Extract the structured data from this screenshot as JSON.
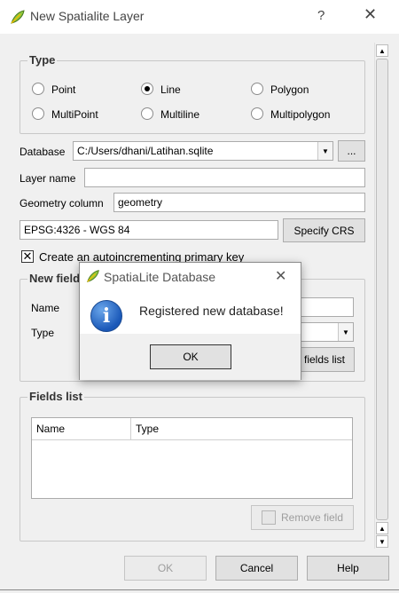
{
  "window": {
    "title": "New Spatialite Layer",
    "help_glyph": "?",
    "close_glyph": "✕",
    "icon": "qgis-leaf-icon"
  },
  "type_group": {
    "title": "Type",
    "options": [
      {
        "label": "Point",
        "checked": false
      },
      {
        "label": "Line",
        "checked": true
      },
      {
        "label": "Polygon",
        "checked": false
      },
      {
        "label": "MultiPoint",
        "checked": false
      },
      {
        "label": "Multiline",
        "checked": false
      },
      {
        "label": "Multipolygon",
        "checked": false
      }
    ]
  },
  "database": {
    "label": "Database",
    "value": "C:/Users/dhani/Latihan.sqlite",
    "browse_label": "..."
  },
  "layer_name": {
    "label": "Layer name",
    "value": ""
  },
  "geometry_column": {
    "label": "Geometry column",
    "value": "geometry"
  },
  "crs": {
    "value": "EPSG:4326 - WGS 84",
    "button_label": "Specify CRS"
  },
  "primary_key": {
    "label": "Create an autoincrementing primary key",
    "checked": true
  },
  "new_field": {
    "title": "New field",
    "name_label": "Name",
    "type_label": "Type",
    "add_button_label": "fields list"
  },
  "fields_list": {
    "title": "Fields list",
    "columns": [
      "Name",
      "Type"
    ],
    "rows": [],
    "remove_button_label": "Remove field"
  },
  "buttons": {
    "ok": "OK",
    "cancel": "Cancel",
    "help": "Help"
  },
  "popup": {
    "title": "SpatiaLite Database",
    "message": "Registered new database!",
    "ok": "OK",
    "close_glyph": "✕",
    "icon": "info-icon"
  },
  "colors": {
    "accent": "#1a58b8",
    "background": "#f0f0f0"
  }
}
